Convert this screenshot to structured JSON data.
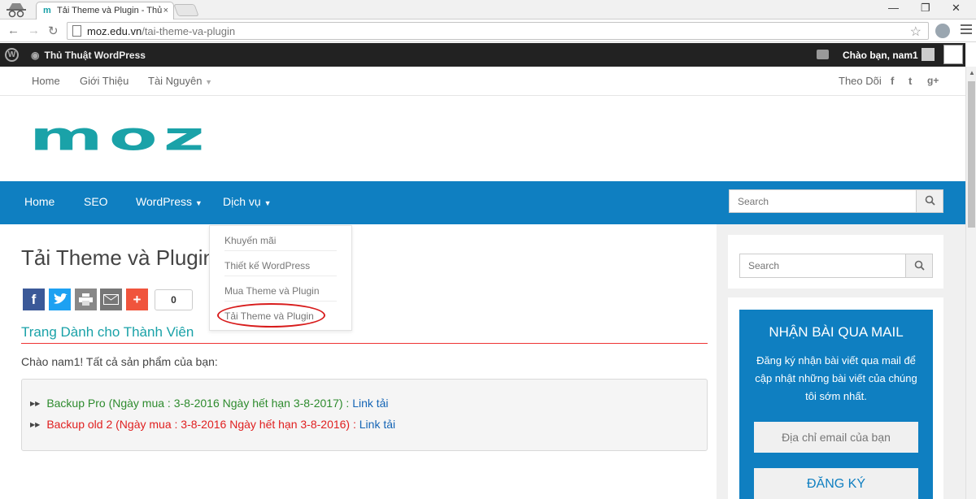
{
  "browser": {
    "tab_title": "Tải Theme và Plugin - Thủ",
    "tab_close": "×",
    "url_domain": "moz.edu.vn",
    "url_path": "/tai-theme-va-plugin",
    "win_min": "—",
    "win_restore": "❐",
    "win_close": "✕"
  },
  "adminbar": {
    "site_name": "Thủ Thuật WordPress",
    "greeting": "Chào bạn, nam1"
  },
  "topnav": {
    "items": [
      "Home",
      "Giới Thiệu",
      "Tài Nguyên"
    ],
    "follow": "Theo Dõi",
    "social": [
      "f",
      "t",
      "g+"
    ]
  },
  "logo": {
    "text": "moz",
    "color": "#1aa2a8"
  },
  "mainnav": {
    "items": [
      "Home",
      "SEO",
      "WordPress",
      "Dịch vụ"
    ],
    "search_placeholder": "Search",
    "color": "#0f7fc1"
  },
  "dropdown": {
    "items": [
      "Khuyến mãi",
      "Thiết kế WordPress",
      "Mua Theme và Plugin",
      "Tải Theme và Plugin"
    ]
  },
  "content": {
    "page_title": "Tải Theme và Plugin",
    "share_count": "0",
    "section_title": "Trang Dành cho Thành Viên",
    "greeting": "Chào nam1! Tất cả sản phẩm của bạn:",
    "products": [
      {
        "name": "Backup Pro (Ngày mua : 3-8-2016 Ngày hết hạn 3-8-2017) :",
        "link": "Link tải",
        "color": "#2e8b2e"
      },
      {
        "name": "Backup old 2 (Ngày mua : 3-8-2016 Ngày hết hạn 3-8-2016) :",
        "link": "Link tải",
        "color": "#e02020"
      }
    ]
  },
  "sidebar": {
    "search_placeholder": "Search",
    "subscribe_title": "NHẬN BÀI QUA MAIL",
    "subscribe_desc": "Đăng ký nhận bài viết qua mail để cập nhật những bài viết của chúng tôi sớm nhất.",
    "email_placeholder": "Địa chỉ email của bạn",
    "subscribe_button": "ĐĂNG KÝ"
  }
}
